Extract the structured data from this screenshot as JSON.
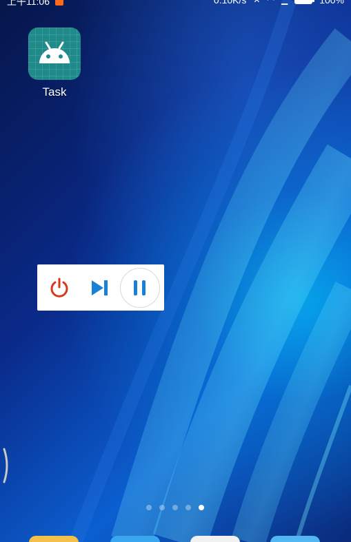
{
  "status_bar": {
    "time": "上午11:06",
    "network_speed": "0.10K/s",
    "battery": "100%",
    "icons": [
      "notification-icon",
      "mute-icon",
      "wifi-icon",
      "signal-icon",
      "battery-icon"
    ]
  },
  "home": {
    "apps": [
      {
        "label": "Task",
        "icon": "android-icon",
        "color": "#1f8a8a"
      }
    ],
    "page_indicator": {
      "count": 5,
      "active_index": 4
    }
  },
  "control_panel": {
    "buttons": [
      {
        "name": "power",
        "icon": "power-icon",
        "color": "#d9361b"
      },
      {
        "name": "next",
        "icon": "skip-next-icon",
        "color": "#1a7fd6"
      },
      {
        "name": "pause",
        "icon": "pause-icon",
        "color": "#1a7fd6"
      }
    ]
  },
  "dock": {
    "icons": [
      "dock-app-1-icon",
      "dock-app-2-icon",
      "dock-app-3-icon",
      "dock-app-4-icon"
    ]
  }
}
